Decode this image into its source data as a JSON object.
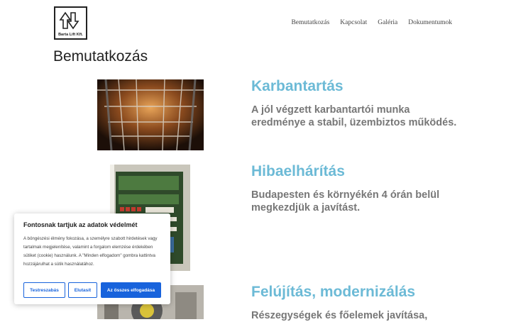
{
  "header": {
    "logo_text": "Barta Lift Kft.",
    "nav": [
      "Bemutatkozás",
      "Kapcsolat",
      "Galéria",
      "Dokumentumok"
    ]
  },
  "page_title": "Bemutatkozás",
  "sections": [
    {
      "title": "Karbantartás",
      "text": "A jól végzett karbantartói munka eredménye a stabil, üzembiztos működés."
    },
    {
      "title": "Hibaelhárítás",
      "text": "Budapesten és környékén 4 órán belül megkezdjük a javítást."
    },
    {
      "title": "Felújítás, modernizálás",
      "text": "Részegységek és főelemek javítása,"
    }
  ],
  "cookie": {
    "title": "Fontosnak tartjuk az adatok védelmét",
    "text": "A böngészési élmény fokozása, a személyre szabott hirdetések vagy tartalmak megjelenítése, valamint a forgalom elemzése érdekében sütiket (cookie) használunk. A \"Minden elfogadom\" gombra kattintva hozzájárulhat a sütik használatához.",
    "btn_customize": "Testreszabás",
    "btn_reject": "Elutasít",
    "btn_accept": "Az összes elfogadása"
  },
  "colors": {
    "accent": "#6cbad6",
    "button": "#1863dc"
  }
}
